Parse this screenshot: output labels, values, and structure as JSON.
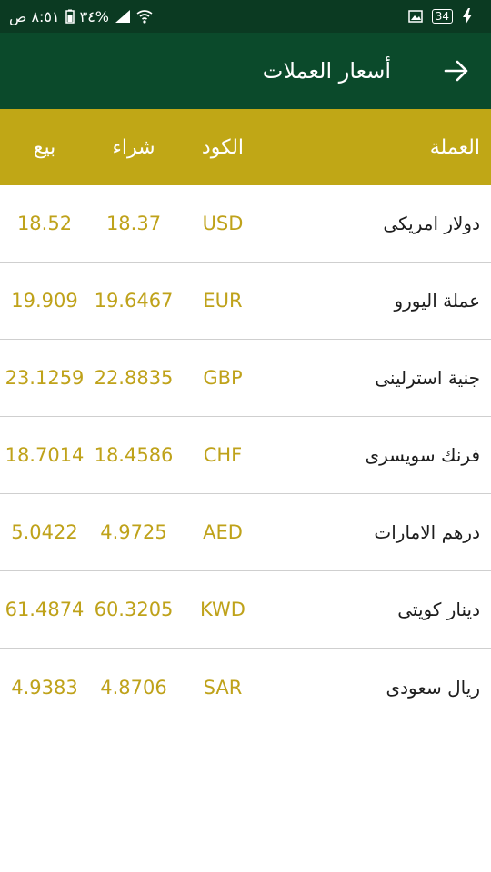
{
  "status_bar": {
    "time": "٨:٥١ ص",
    "battery_percent": "%٣٤",
    "battery_level_badge": "34"
  },
  "app_bar": {
    "title": "أسعار العملات"
  },
  "table": {
    "headers": {
      "currency": "العملة",
      "code": "الكود",
      "buy": "شراء",
      "sell": "بيع"
    },
    "rows": [
      {
        "name": "دولار امريكى",
        "code": "USD",
        "buy": "18.37",
        "sell": "18.52"
      },
      {
        "name": "عملة اليورو",
        "code": "EUR",
        "buy": "19.6467",
        "sell": "19.909"
      },
      {
        "name": "جنية استرلينى",
        "code": "GBP",
        "buy": "22.8835",
        "sell": "23.1259"
      },
      {
        "name": "فرنك سويسرى",
        "code": "CHF",
        "buy": "18.4586",
        "sell": "18.7014"
      },
      {
        "name": "درهم الامارات",
        "code": "AED",
        "buy": "4.9725",
        "sell": "5.0422"
      },
      {
        "name": "دينار كويتى",
        "code": "KWD",
        "buy": "60.3205",
        "sell": "61.4874"
      },
      {
        "name": "ريال سعودى",
        "code": "SAR",
        "buy": "4.8706",
        "sell": "4.9383"
      }
    ]
  },
  "colors": {
    "status_bar_bg": "#0b3a22",
    "app_bar_bg": "#0b4a2b",
    "header_bg": "#c0a716",
    "value_text": "#bfa21a"
  },
  "icons": [
    "wifi-icon",
    "signal-icon",
    "battery-icon",
    "image-notification-icon",
    "battery-level-icon",
    "charging-icon",
    "back-arrow-icon"
  ]
}
